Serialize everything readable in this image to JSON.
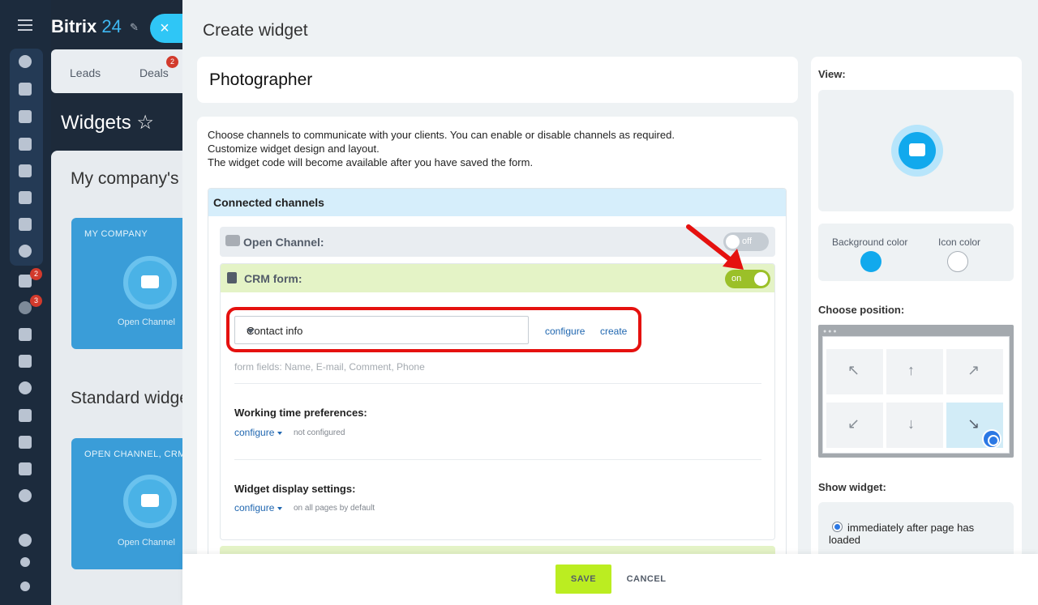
{
  "background_app": {
    "logo_text": "Bitrix",
    "logo_number": "24",
    "close_glyph": "×",
    "tabs": [
      {
        "label": "Leads"
      },
      {
        "label": "Deals",
        "badge": "2"
      }
    ],
    "page_title": "Widgets ☆",
    "sections": [
      {
        "title": "My company's"
      },
      {
        "title": "Standard widge"
      }
    ],
    "cards": [
      {
        "caption": "MY COMPANY",
        "name": "Open Channel"
      },
      {
        "caption": "OPEN CHANNEL, CRM",
        "name": "Open Channel"
      }
    ],
    "rail_badges": [
      "2",
      "3"
    ]
  },
  "dialog": {
    "title": "Create widget",
    "widget_name": "Photographer",
    "intro_lines": [
      "Choose channels to communicate with your clients. You can enable or disable channels as required.",
      "Customize widget design and layout.",
      "The widget code will become available after you have saved the form."
    ],
    "connected_channels": {
      "header": "Connected channels",
      "open_channel": {
        "label": "Open Channel:",
        "toggle_text": "off",
        "enabled": false
      },
      "crm_form": {
        "label": "CRM form:",
        "toggle_text": "on",
        "enabled": true,
        "selected_form": "Contact info",
        "configure_link": "configure",
        "create_link": "create",
        "fields_hint": "form fields: Name, E-mail, Comment, Phone",
        "working_time": {
          "title": "Working time preferences:",
          "link": "configure",
          "note": "not configured"
        },
        "display": {
          "title": "Widget display settings:",
          "link": "configure",
          "note": "on all pages by default"
        }
      }
    },
    "side": {
      "view_label": "View:",
      "background_color_label": "Background color",
      "icon_color_label": "Icon color",
      "background_color": "#11a9ed",
      "icon_color": "#ffffff",
      "position_label": "Choose position:",
      "position_arrows": [
        "↖",
        "↑",
        "↗",
        "↙",
        "↓",
        "↘"
      ],
      "selected_position": "bottom-right",
      "show_widget_label": "Show widget:",
      "show_option": "immediately after page has loaded"
    },
    "footer": {
      "save": "SAVE",
      "cancel": "CANCEL"
    }
  },
  "colors": {
    "accent": "#2fc6f6",
    "toggle_on": "#9bc028",
    "save_button": "#bbed21",
    "highlight": "#e5110f"
  }
}
